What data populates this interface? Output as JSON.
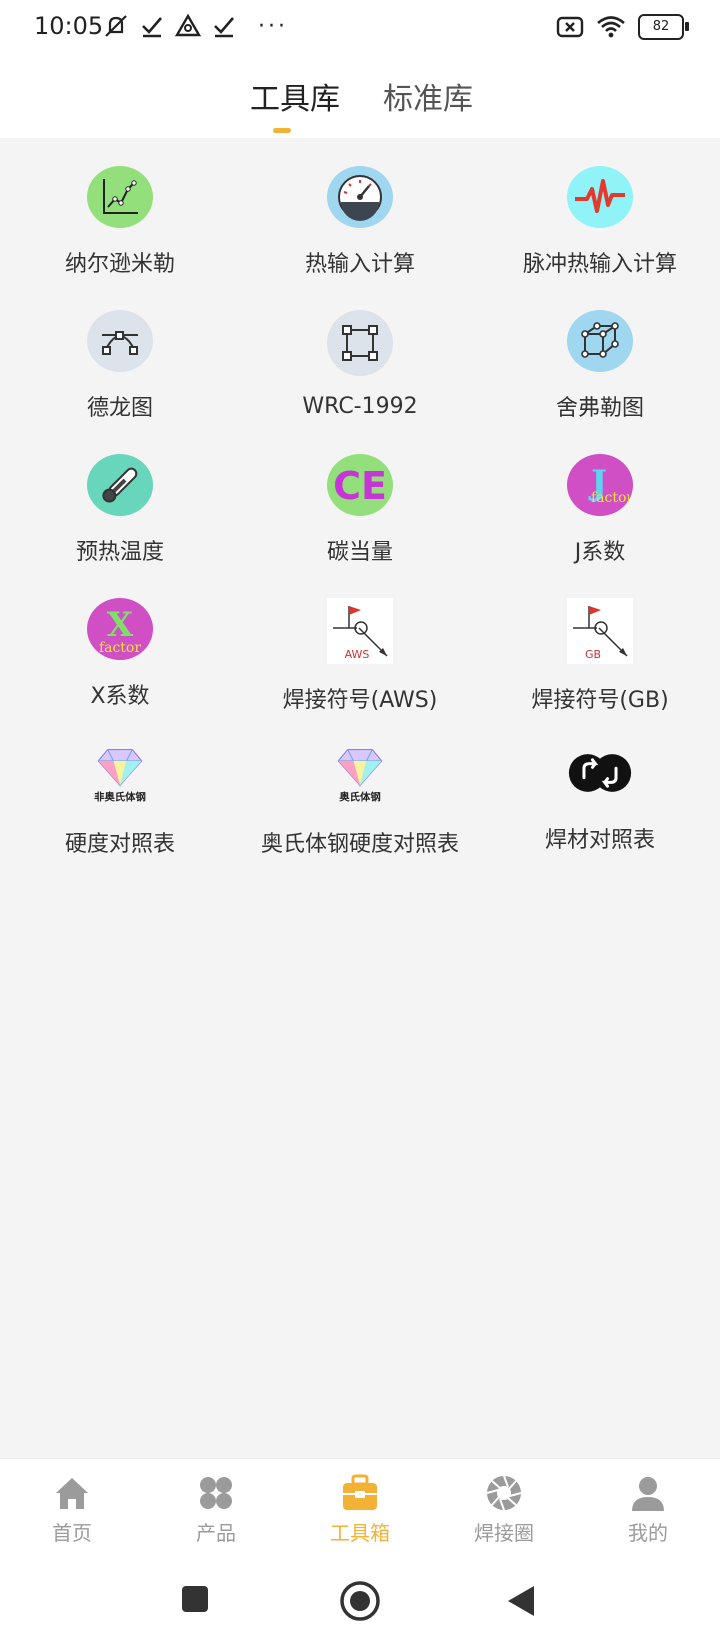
{
  "status": {
    "time": "10:05",
    "battery": "82"
  },
  "tabs": [
    {
      "label": "工具库",
      "active": true
    },
    {
      "label": "标准库",
      "active": false
    }
  ],
  "tools": [
    {
      "label": "纳尔逊米勒",
      "icon": "line-chart-icon"
    },
    {
      "label": "热输入计算",
      "icon": "gauge-icon"
    },
    {
      "label": "脉冲热输入计算",
      "icon": "pulse-icon"
    },
    {
      "label": "德龙图",
      "icon": "bezier-curve-icon"
    },
    {
      "label": "WRC-1992",
      "icon": "vector-square-icon"
    },
    {
      "label": "舍弗勒图",
      "icon": "cube-icon"
    },
    {
      "label": "预热温度",
      "icon": "thermometer-icon"
    },
    {
      "label": "碳当量",
      "icon": "ce-icon"
    },
    {
      "label": "J系数",
      "icon": "j-factor-icon"
    },
    {
      "label": "X系数",
      "icon": "x-factor-icon"
    },
    {
      "label": "焊接符号(AWS)",
      "icon": "weld-symbol-aws-icon",
      "badge": "AWS"
    },
    {
      "label": "焊接符号(GB)",
      "icon": "weld-symbol-gb-icon",
      "badge": "GB"
    },
    {
      "label": "硬度对照表",
      "icon": "diamond-icon",
      "badge": "非奥氏体钢"
    },
    {
      "label": "奥氏体钢硬度对照表",
      "icon": "diamond-icon",
      "badge": "奥氏体钢"
    },
    {
      "label": "焊材对照表",
      "icon": "exchange-icon"
    }
  ],
  "bottom_nav": [
    {
      "label": "首页",
      "icon": "home-icon",
      "active": false
    },
    {
      "label": "产品",
      "icon": "grid-icon",
      "active": false
    },
    {
      "label": "工具箱",
      "icon": "toolbox-icon",
      "active": true
    },
    {
      "label": "焊接圈",
      "icon": "aperture-icon",
      "active": false
    },
    {
      "label": "我的",
      "icon": "user-icon",
      "active": false
    }
  ],
  "colors": {
    "accent": "#f2b236",
    "inactive": "#9b9b9b"
  }
}
